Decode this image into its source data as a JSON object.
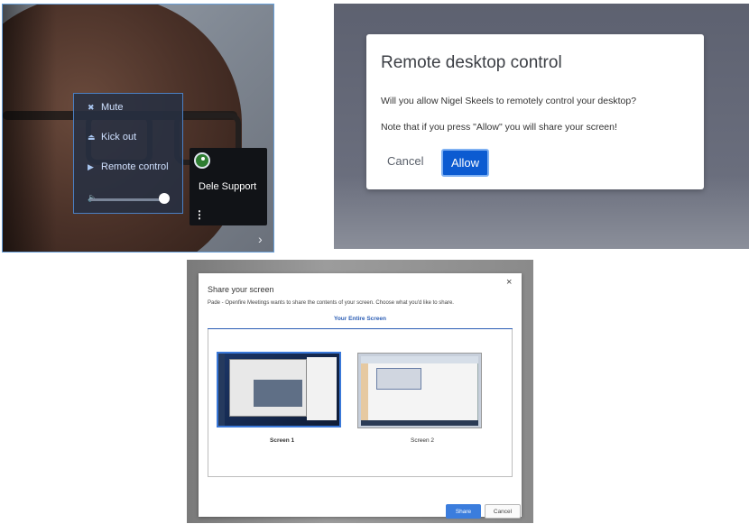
{
  "video_panel": {
    "menu": {
      "mute": {
        "icon": "mic-off-icon",
        "label": "Mute"
      },
      "kick": {
        "icon": "eject-icon",
        "label": "Kick out"
      },
      "remote": {
        "icon": "play-icon",
        "label": "Remote control"
      },
      "volume": {
        "icon": "volume-icon",
        "level": 1.0
      }
    },
    "participant": {
      "name": "Dele Support",
      "avatar_color": "#2e7d32"
    }
  },
  "remote_dialog": {
    "title": "Remote desktop control",
    "question": "Will you allow Nigel Skeels to remotely control your desktop?",
    "note": "Note that if you press \"Allow\" you will share your screen!",
    "cancel_label": "Cancel",
    "allow_label": "Allow",
    "accent": "#0c5bd1"
  },
  "share_dialog": {
    "title": "Share your screen",
    "description": "Pade - Openfire Meetings wants to share the contents of your screen. Choose what you'd like to share.",
    "tab": "Your Entire Screen",
    "screens": [
      {
        "label": "Screen 1",
        "selected": true
      },
      {
        "label": "Screen 2",
        "selected": false
      }
    ],
    "share_label": "Share",
    "cancel_label": "Cancel",
    "close_glyph": "×",
    "accent": "#3b7ddd"
  }
}
